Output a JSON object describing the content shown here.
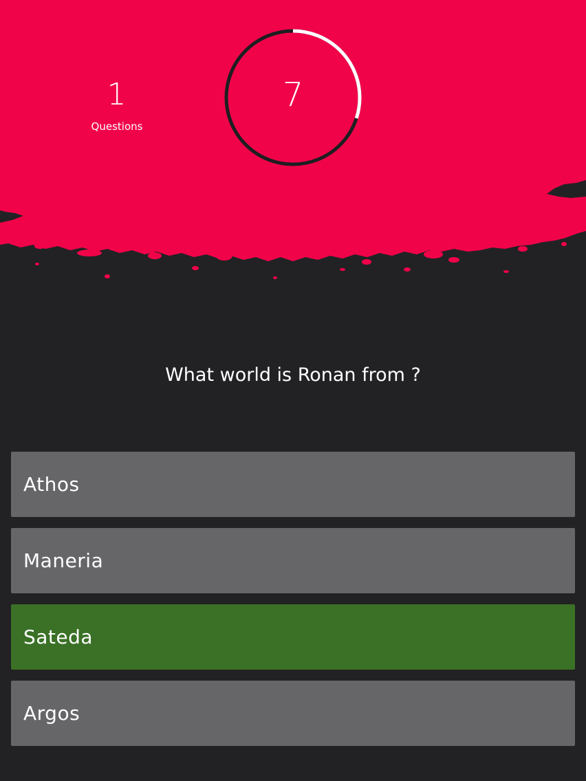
{
  "colors": {
    "header": "#f1034a",
    "background": "#222224",
    "answer_default": "#666568",
    "answer_correct": "#3a7126",
    "text": "#ffffff"
  },
  "counter": {
    "value": "1",
    "caption": "Questions"
  },
  "timer": {
    "value": "7",
    "progress_fraction": 0.3
  },
  "question": {
    "text": "What world is Ronan from ?"
  },
  "answers": [
    {
      "label": "Athos",
      "state": "default"
    },
    {
      "label": "Maneria",
      "state": "default"
    },
    {
      "label": "Sateda",
      "state": "correct"
    },
    {
      "label": "Argos",
      "state": "default"
    }
  ]
}
